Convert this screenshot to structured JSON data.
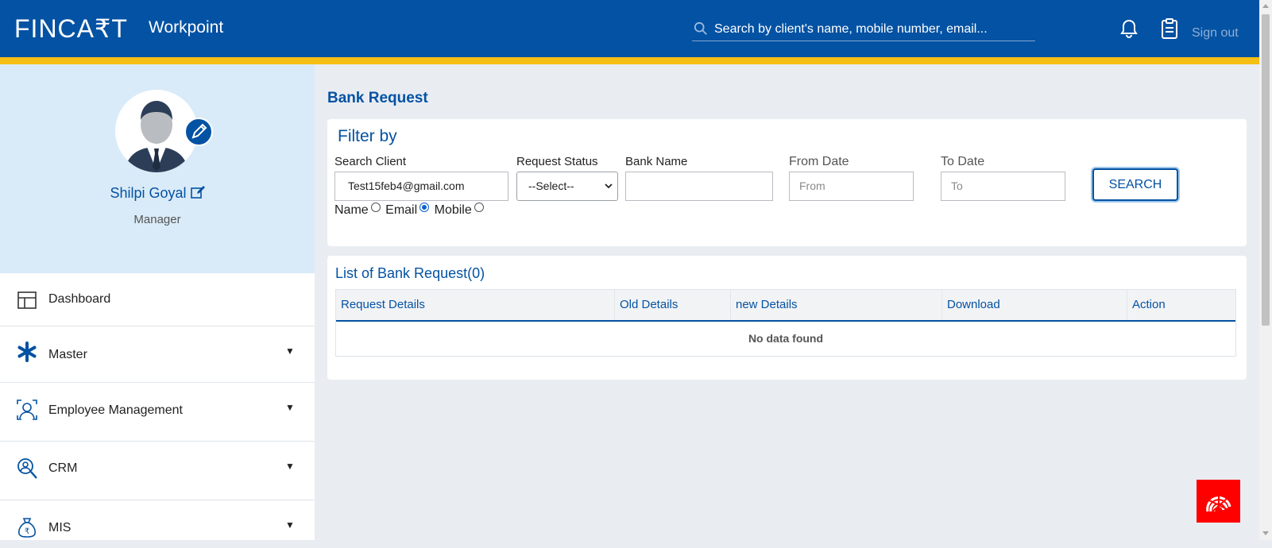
{
  "header": {
    "logo": "FINCA₹T",
    "app_name": "Workpoint",
    "search_placeholder": "Search by client's name,  mobile number, email...",
    "signout": "Sign out",
    "icons": [
      "search-icon",
      "bell-icon",
      "clipboard-icon"
    ]
  },
  "profile": {
    "name": "Shilpi Goyal",
    "role": "Manager"
  },
  "sidebar": {
    "items": [
      {
        "label": "Dashboard",
        "icon": "dashboard-icon",
        "expandable": false
      },
      {
        "label": "Master",
        "icon": "asterisk-icon",
        "expandable": true
      },
      {
        "label": "Employee Management",
        "icon": "employee-icon",
        "expandable": true
      },
      {
        "label": "CRM",
        "icon": "crm-icon",
        "expandable": true
      },
      {
        "label": "MIS",
        "icon": "rupee-bag-icon",
        "expandable": true
      }
    ],
    "caret": "▼"
  },
  "page": {
    "title": "Bank Request"
  },
  "filter": {
    "title": "Filter by",
    "search_client_label": "Search Client",
    "search_client_value": "Test15feb4@gmail.com",
    "request_status_label": "Request Status",
    "request_status_value": "--Select--",
    "bank_name_label": "Bank Name",
    "bank_name_value": "",
    "from_date_label": "From Date",
    "from_date_placeholder": "From",
    "to_date_label": "To Date",
    "to_date_placeholder": "To",
    "search_button": "SEARCH",
    "radio_options": [
      "Name",
      "Email",
      "Mobile"
    ],
    "radio_selected": "Email"
  },
  "list": {
    "title": "List of Bank Request(0)",
    "columns": [
      "Request Details",
      "Old Details",
      "new Details",
      "Download",
      "Action"
    ],
    "empty_text": "No data found"
  },
  "colors": {
    "primary": "#0452a3",
    "stripe": "#f6bf14",
    "profile_bg": "#d9ebf8",
    "fab": "#ff0000"
  }
}
